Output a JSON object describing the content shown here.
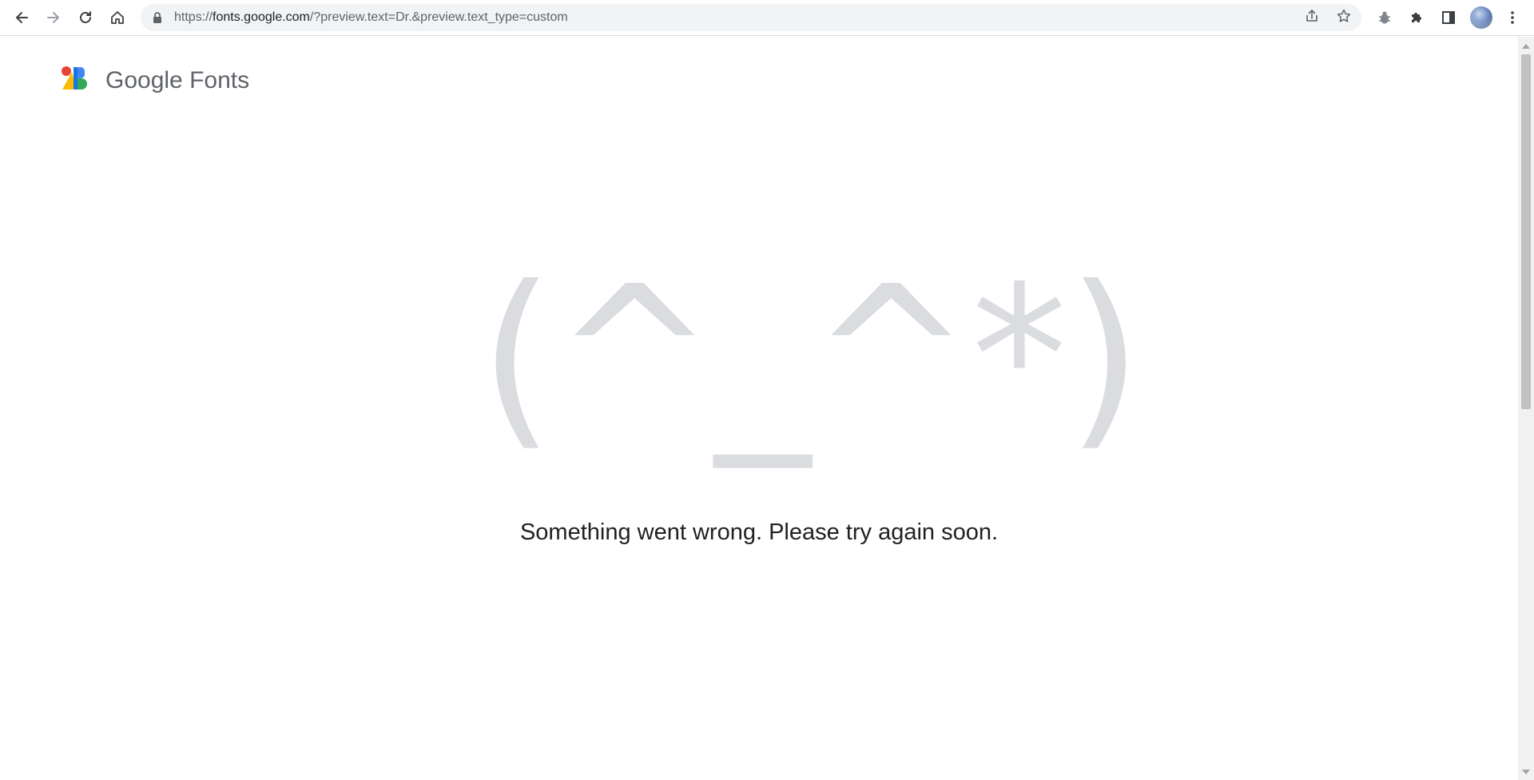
{
  "browser": {
    "url_host": "fonts.google.com",
    "url_scheme": "https://",
    "url_path": "/?preview.text=Dr.&preview.text_type=custom",
    "icons": {
      "back": "back-arrow-icon",
      "forward": "forward-arrow-icon",
      "reload": "reload-icon",
      "home": "home-icon",
      "lock": "lock-icon",
      "share": "share-icon",
      "bookmark": "star-icon",
      "extension_bug": "bug-icon",
      "extensions": "puzzle-icon",
      "side_panel": "side-panel-icon",
      "menu": "kebab-menu-icon"
    }
  },
  "header": {
    "logo_text": "Google Fonts"
  },
  "error": {
    "kaomoji": "(^_^*)",
    "message": "Something went wrong. Please try again soon."
  },
  "colors": {
    "kaomoji": "#dadce0",
    "message": "#202124",
    "logo_text": "#5f6368"
  }
}
